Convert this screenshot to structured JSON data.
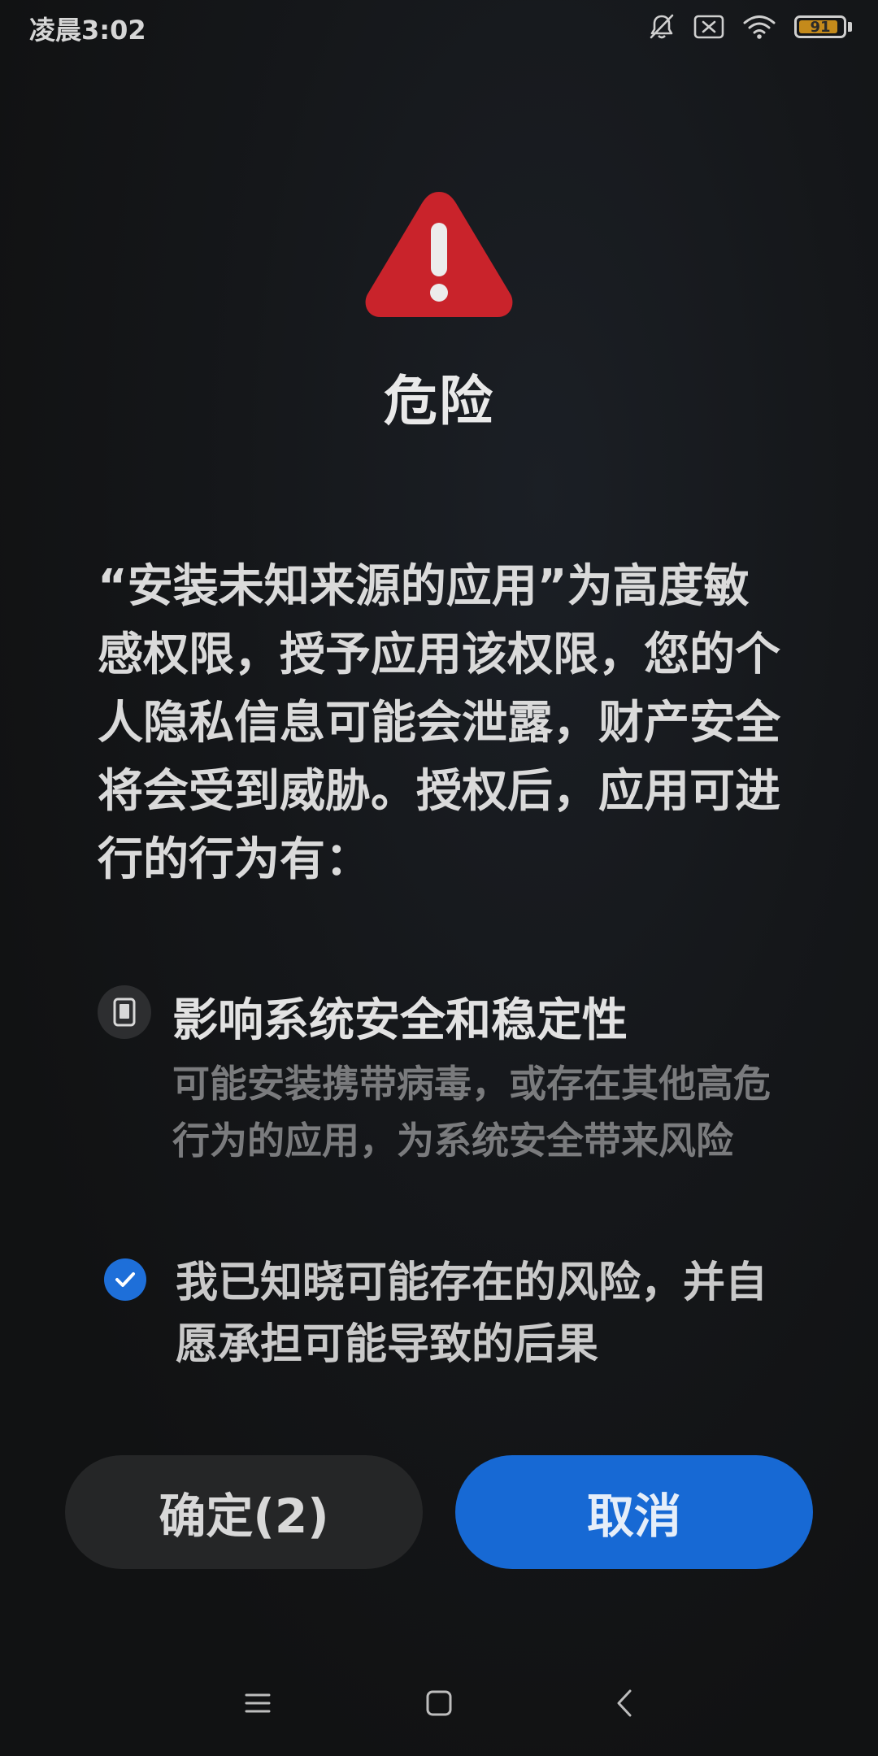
{
  "status_bar": {
    "time": "凌晨3:02",
    "battery_level": "91",
    "battery_percent": 91,
    "icons": [
      "bell-muted-icon",
      "sim-none-icon",
      "wifi-icon",
      "battery-icon"
    ]
  },
  "dialog": {
    "warning_icon": "warning-triangle-icon",
    "title": "危险",
    "description": "“安装未知来源的应用”为高度敏感权限，授予应用该权限，您的个人隐私信息可能会泄露，财产安全将会受到威胁。授权后，应用可进行的行为有：",
    "permission": {
      "icon": "phone-icon",
      "title": "影响系统安全和稳定性",
      "description": "可能安装携带病毒，或存在其他高危行为的应用，为系统安全带来风险"
    },
    "consent": {
      "checked": true,
      "text": "我已知晓可能存在的风险，并自愿承担可能导致的后果"
    },
    "confirm_label": "确定(2)",
    "cancel_label": "取消"
  },
  "colors": {
    "danger": "#c9232b",
    "accent": "#1769d4",
    "background": "#121314"
  },
  "nav_bar": {
    "icons": [
      "menu-icon",
      "home-icon",
      "back-icon"
    ]
  }
}
